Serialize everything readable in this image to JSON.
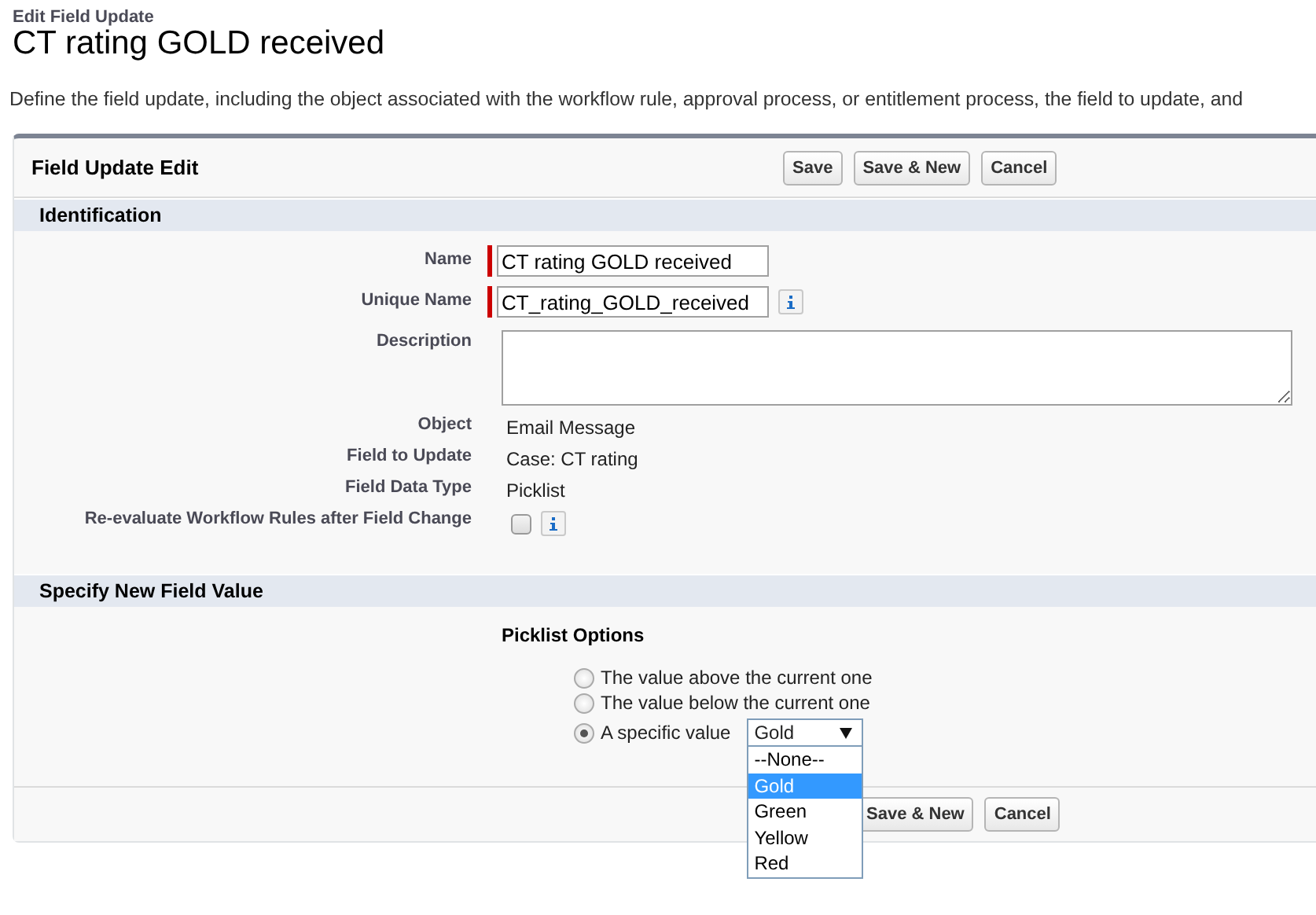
{
  "page": {
    "breadcrumb": "Edit Field Update",
    "title": "CT rating GOLD received",
    "description": "Define the field update, including the object associated with the workflow rule, approval process, or entitlement process, the field to update, and"
  },
  "panel": {
    "title": "Field Update Edit",
    "buttons": [
      "Save",
      "Save & New",
      "Cancel"
    ]
  },
  "identification": {
    "title": "Identification",
    "fields": [
      {
        "label": "Name",
        "kind": "text",
        "value": "CT rating GOLD received",
        "required": true,
        "info": false
      },
      {
        "label": "Unique Name",
        "kind": "text",
        "value": "CT_rating_GOLD_received",
        "required": true,
        "info": true
      },
      {
        "label": "Description",
        "kind": "textarea",
        "required": false,
        "info": false
      },
      {
        "label": "Object",
        "kind": "static",
        "value": "Email Message",
        "required": false,
        "info": false
      },
      {
        "label": "Field to Update",
        "kind": "static",
        "value": "Case: CT rating",
        "required": false,
        "info": false
      },
      {
        "label": "Field Data Type",
        "kind": "static",
        "value": "Picklist",
        "required": false,
        "info": false
      },
      {
        "label": "Re-evaluate Workflow Rules after Field Change",
        "kind": "checkbox",
        "checked": false,
        "required": false,
        "info": true
      }
    ]
  },
  "new_value": {
    "title": "Specify New Field Value",
    "heading": "Picklist Options",
    "options": [
      {
        "label": "The value above the current one",
        "selected": false
      },
      {
        "label": "The value below the current one",
        "selected": false
      },
      {
        "label": "A specific value",
        "selected": true
      }
    ],
    "select": {
      "value": "Gold",
      "expanded": true,
      "items": [
        {
          "label": "--None--",
          "selected": false
        },
        {
          "label": "Gold",
          "selected": true
        },
        {
          "label": "Green",
          "selected": false
        },
        {
          "label": "Yellow",
          "selected": false
        },
        {
          "label": "Red",
          "selected": false
        }
      ]
    }
  },
  "footer_buttons": [
    "Save & New",
    "Cancel"
  ]
}
